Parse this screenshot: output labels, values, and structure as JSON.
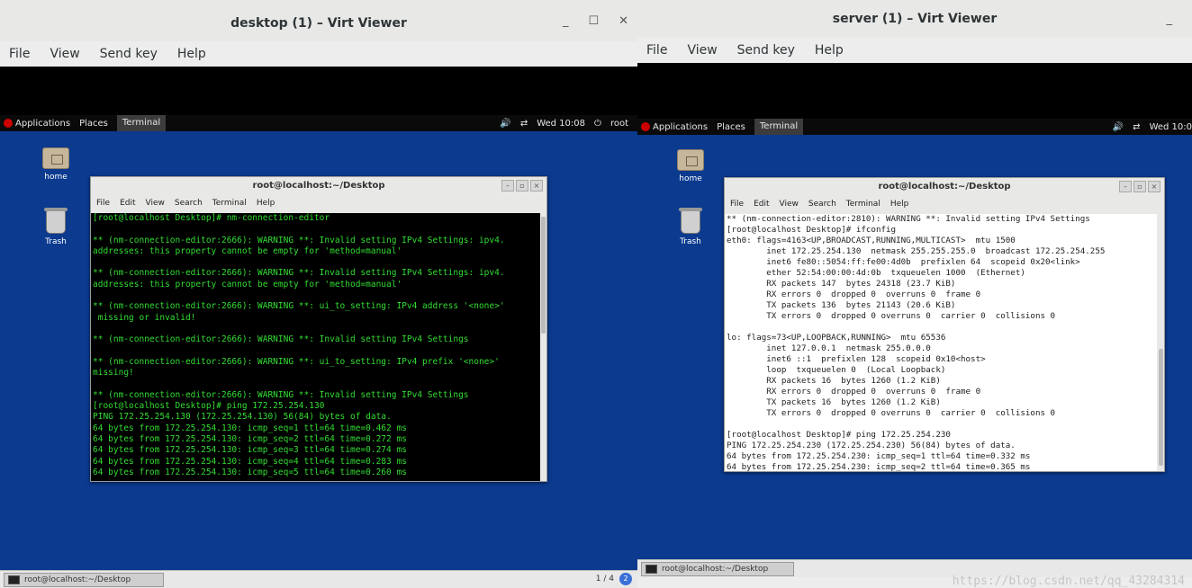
{
  "left": {
    "window_title": "desktop (1) – Virt Viewer",
    "menu": [
      "File",
      "View",
      "Send key",
      "Help"
    ],
    "topbar": {
      "applications": "Applications",
      "places": "Places",
      "terminal": "Terminal",
      "clock": "Wed 10:08",
      "user": "root"
    },
    "desktop_icons": {
      "home": "home",
      "trash": "Trash"
    },
    "terminal": {
      "title": "root@localhost:~/Desktop",
      "menu": [
        "File",
        "Edit",
        "View",
        "Search",
        "Terminal",
        "Help"
      ],
      "lines": [
        "[root@localhost Desktop]# nm-connection-editor",
        "",
        "** (nm-connection-editor:2666): WARNING **: Invalid setting IPv4 Settings: ipv4.",
        "addresses: this property cannot be empty for 'method=manual'",
        "",
        "** (nm-connection-editor:2666): WARNING **: Invalid setting IPv4 Settings: ipv4.",
        "addresses: this property cannot be empty for 'method=manual'",
        "",
        "** (nm-connection-editor:2666): WARNING **: ui_to_setting: IPv4 address '<none>'",
        " missing or invalid!",
        "",
        "** (nm-connection-editor:2666): WARNING **: Invalid setting IPv4 Settings",
        "",
        "** (nm-connection-editor:2666): WARNING **: ui_to_setting: IPv4 prefix '<none>'",
        "missing!",
        "",
        "** (nm-connection-editor:2666): WARNING **: Invalid setting IPv4 Settings",
        "[root@localhost Desktop]# ping 172.25.254.130",
        "PING 172.25.254.130 (172.25.254.130) 56(84) bytes of data.",
        "64 bytes from 172.25.254.130: icmp_seq=1 ttl=64 time=0.462 ms",
        "64 bytes from 172.25.254.130: icmp_seq=2 ttl=64 time=0.272 ms",
        "64 bytes from 172.25.254.130: icmp_seq=3 ttl=64 time=0.274 ms",
        "64 bytes from 172.25.254.130: icmp_seq=4 ttl=64 time=0.283 ms",
        "64 bytes from 172.25.254.130: icmp_seq=5 ttl=64 time=0.260 ms"
      ]
    },
    "taskbar": {
      "item": "root@localhost:~/Desktop",
      "pager": "1 / 4",
      "badge": "2"
    }
  },
  "right": {
    "window_title": "server (1) – Virt Viewer",
    "menu": [
      "File",
      "View",
      "Send key",
      "Help"
    ],
    "topbar": {
      "applications": "Applications",
      "places": "Places",
      "terminal": "Terminal",
      "clock": "Wed 10:0"
    },
    "desktop_icons": {
      "home": "home",
      "trash": "Trash"
    },
    "terminal": {
      "title": "root@localhost:~/Desktop",
      "menu": [
        "File",
        "Edit",
        "View",
        "Search",
        "Terminal",
        "Help"
      ],
      "lines": [
        "** (nm-connection-editor:2810): WARNING **: Invalid setting IPv4 Settings",
        "[root@localhost Desktop]# ifconfig",
        "eth0: flags=4163<UP,BROADCAST,RUNNING,MULTICAST>  mtu 1500",
        "        inet 172.25.254.130  netmask 255.255.255.0  broadcast 172.25.254.255",
        "        inet6 fe80::5054:ff:fe00:4d0b  prefixlen 64  scopeid 0x20<link>",
        "        ether 52:54:00:00:4d:0b  txqueuelen 1000  (Ethernet)",
        "        RX packets 147  bytes 24318 (23.7 KiB)",
        "        RX errors 0  dropped 0  overruns 0  frame 0",
        "        TX packets 136  bytes 21143 (20.6 KiB)",
        "        TX errors 0  dropped 0 overruns 0  carrier 0  collisions 0",
        "",
        "lo: flags=73<UP,LOOPBACK,RUNNING>  mtu 65536",
        "        inet 127.0.0.1  netmask 255.0.0.0",
        "        inet6 ::1  prefixlen 128  scopeid 0x10<host>",
        "        loop  txqueuelen 0  (Local Loopback)",
        "        RX packets 16  bytes 1260 (1.2 KiB)",
        "        RX errors 0  dropped 0  overruns 0  frame 0",
        "        TX packets 16  bytes 1260 (1.2 KiB)",
        "        TX errors 0  dropped 0 overruns 0  carrier 0  collisions 0",
        "",
        "[root@localhost Desktop]# ping 172.25.254.230",
        "PING 172.25.254.230 (172.25.254.230) 56(84) bytes of data.",
        "64 bytes from 172.25.254.230: icmp_seq=1 ttl=64 time=0.332 ms",
        "64 bytes from 172.25.254.230: icmp_seq=2 ttl=64 time=0.365 ms"
      ]
    },
    "taskbar": {
      "item": "root@localhost:~/Desktop"
    },
    "watermark": "https://blog.csdn.net/qq_43284314"
  }
}
